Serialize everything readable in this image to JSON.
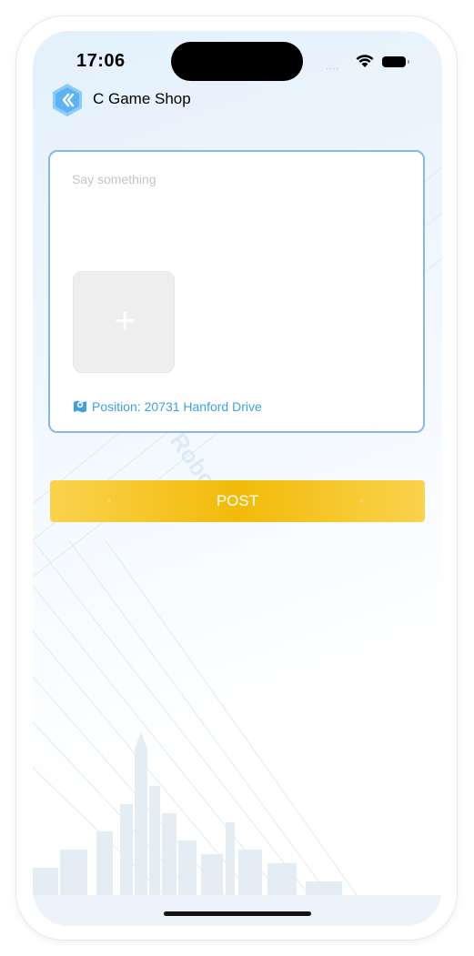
{
  "status_bar": {
    "time": "17:06",
    "signal": "....",
    "icons": [
      "wifi-icon",
      "battery-icon"
    ]
  },
  "header": {
    "back_icon": "chevron-left-icon",
    "title": "C Game Shop"
  },
  "compose": {
    "text_placeholder": "Say something",
    "text_value": "",
    "add_photo_symbol": "+",
    "position_icon": "map-pin-icon",
    "position_text": "Position: 20731 Hanford Drive"
  },
  "actions": {
    "post_label": "POST"
  },
  "colors": {
    "card_border": "#8ab6e8",
    "position_text": "#3ea0dd",
    "post_button": "#f2bb0a",
    "back_button": "#6db8f5"
  }
}
